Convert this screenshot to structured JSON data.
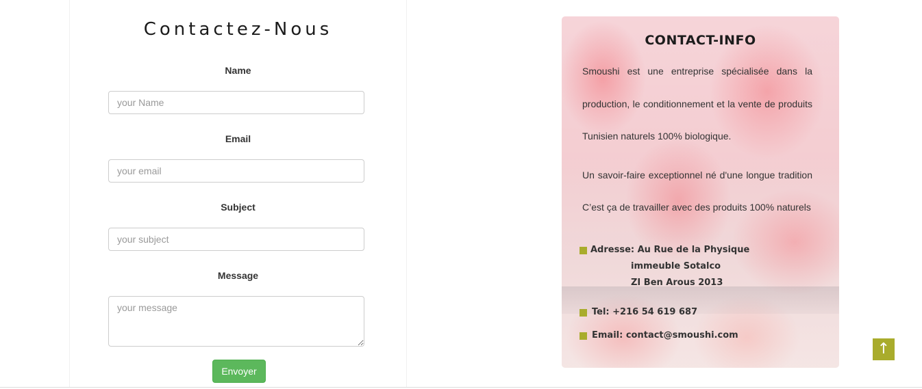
{
  "form": {
    "title": "Contactez-Nous",
    "name_label": "Name",
    "name_placeholder": "your Name",
    "email_label": "Email",
    "email_placeholder": "your email",
    "subject_label": "Subject",
    "subject_placeholder": "your subject",
    "message_label": "Message",
    "message_placeholder": "your message",
    "submit_label": "Envoyer"
  },
  "contact_info": {
    "title": "CONTACT-INFO",
    "description_lines": [
      "Smoushi est une entreprise spécialisée dans la",
      "production, le conditionnement et la vente de produits",
      "Tunisien naturels 100% biologique.",
      "Un savoir-faire exceptionnel né d'une longue tradition",
      "C’est ça de travailler avec des produits 100% naturels"
    ],
    "address_line1": "Adresse: Au Rue de la Physique",
    "address_line2": "immeuble Sotalco",
    "address_line3": "ZI Ben Arous 2013",
    "tel": "Tel: +216 54 619 687",
    "email": "Email: contact@smoushi.com"
  },
  "scroll_top": {
    "icon": "arrow-up-icon",
    "glyph": "↑"
  },
  "colors": {
    "accent": "#a9ac2c",
    "submit": "#5cb85c"
  }
}
